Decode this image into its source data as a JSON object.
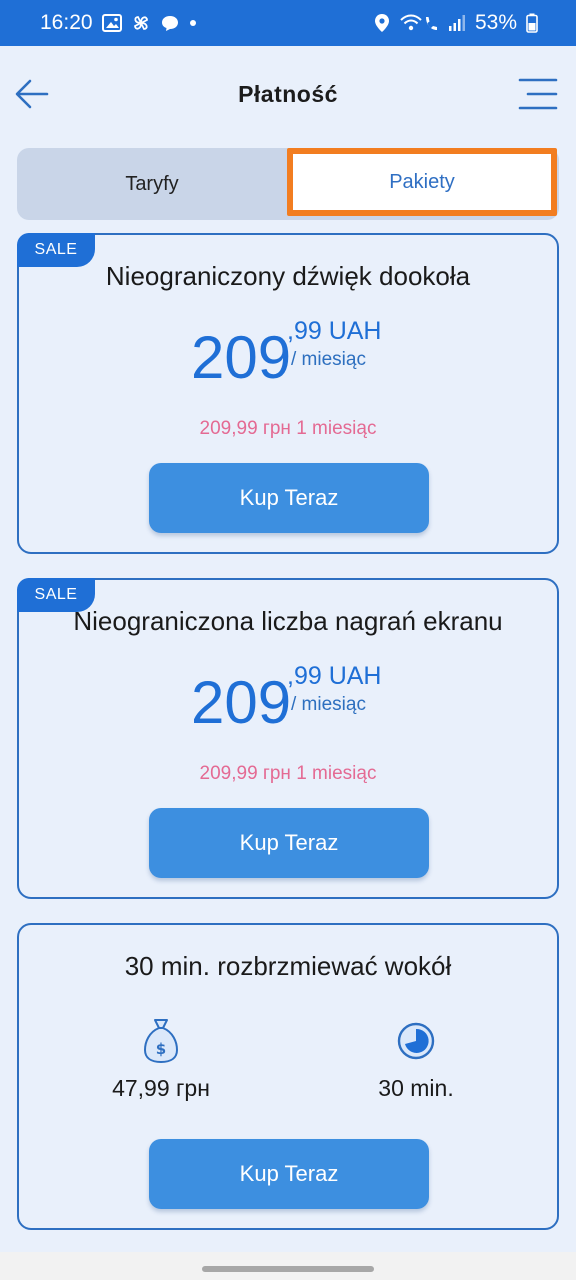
{
  "status_bar": {
    "time": "16:20",
    "battery": "53%"
  },
  "header": {
    "title": "Płatność"
  },
  "tabs": [
    {
      "label": "Taryfy",
      "active": false
    },
    {
      "label": "Pakiety",
      "active": true
    }
  ],
  "cards": [
    {
      "badge": "SALE",
      "title": "Nieograniczony dźwięk dookoła",
      "price_main": "209",
      "price_cents": ",99 UAH",
      "price_period": "/ miesiąc",
      "note": "209,99 грн 1 miesiąc",
      "button_label": "Kup Teraz"
    },
    {
      "badge": "SALE",
      "title": "Nieograniczona liczba nagrań ekranu",
      "price_main": "209",
      "price_cents": ",99 UAH",
      "price_period": "/ miesiąc",
      "note": "209,99 грн 1 miesiąc",
      "button_label": "Kup Teraz"
    },
    {
      "title": "30 min. rozbrzmiewać wokół",
      "price_value": "47,99 грн",
      "duration_value": "30 min.",
      "price_icon": "money-bag-icon",
      "duration_icon": "clock-icon",
      "button_label": "Kup Teraz"
    }
  ],
  "colors": {
    "accent": "#1f6fd6",
    "button": "#3d8fe0",
    "highlight_border": "#f27d20",
    "note_pink": "#e46a93"
  }
}
